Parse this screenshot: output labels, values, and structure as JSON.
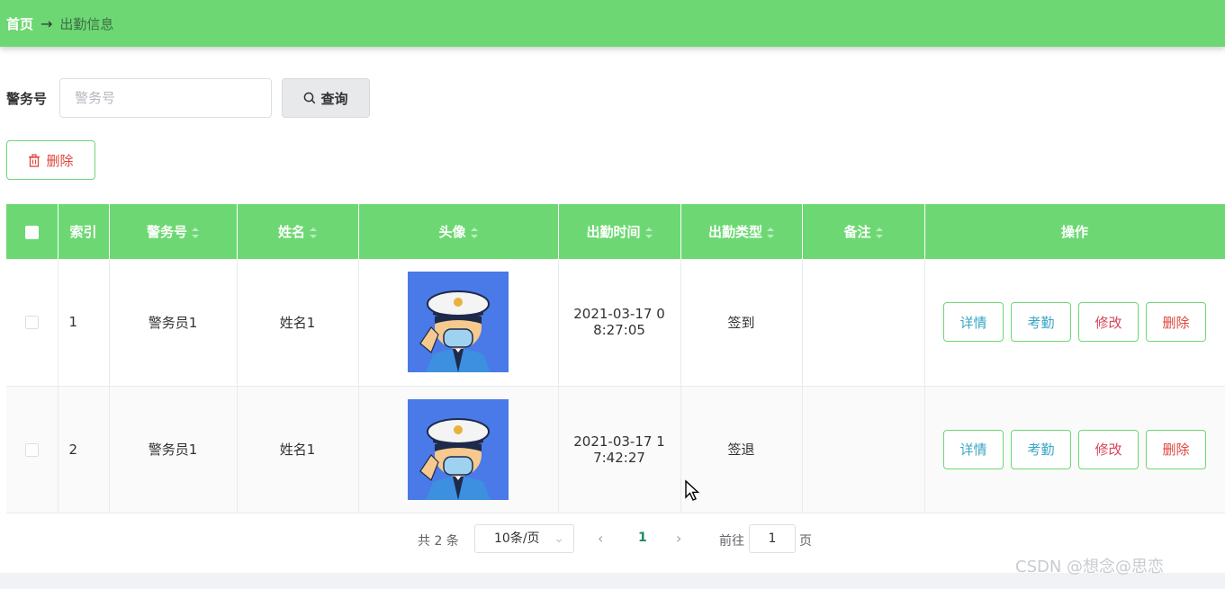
{
  "breadcrumb": {
    "home": "首页",
    "separator": "→",
    "current": "出勤信息"
  },
  "search": {
    "label": "警务号",
    "placeholder": "警务号",
    "value": "",
    "query_label": "查询"
  },
  "toolbar": {
    "delete_label": "删除"
  },
  "table": {
    "columns": [
      "索引",
      "警务号",
      "姓名",
      "头像",
      "出勤时间",
      "出勤类型",
      "备注",
      "操作"
    ],
    "rows": [
      {
        "index": "1",
        "officer_no": "警务员1",
        "name": "姓名1",
        "time_line1": "2021-03-17 0",
        "time_line2": "8:27:05",
        "type": "签到",
        "remark": ""
      },
      {
        "index": "2",
        "officer_no": "警务员1",
        "name": "姓名1",
        "time_line1": "2021-03-17 1",
        "time_line2": "7:42:27",
        "type": "签退",
        "remark": ""
      }
    ],
    "actions": {
      "detail": "详情",
      "attendance": "考勤",
      "edit": "修改",
      "delete": "删除"
    }
  },
  "pagination": {
    "total": "共 2 条",
    "page_size": "10条/页",
    "current_page": "1",
    "goto_prefix": "前往",
    "goto_value": "1",
    "goto_suffix": "页"
  },
  "watermark": "CSDN @想念@思恋",
  "colors": {
    "accent": "#6dd873",
    "danger": "#e0453d",
    "info": "#3aa6c6"
  }
}
